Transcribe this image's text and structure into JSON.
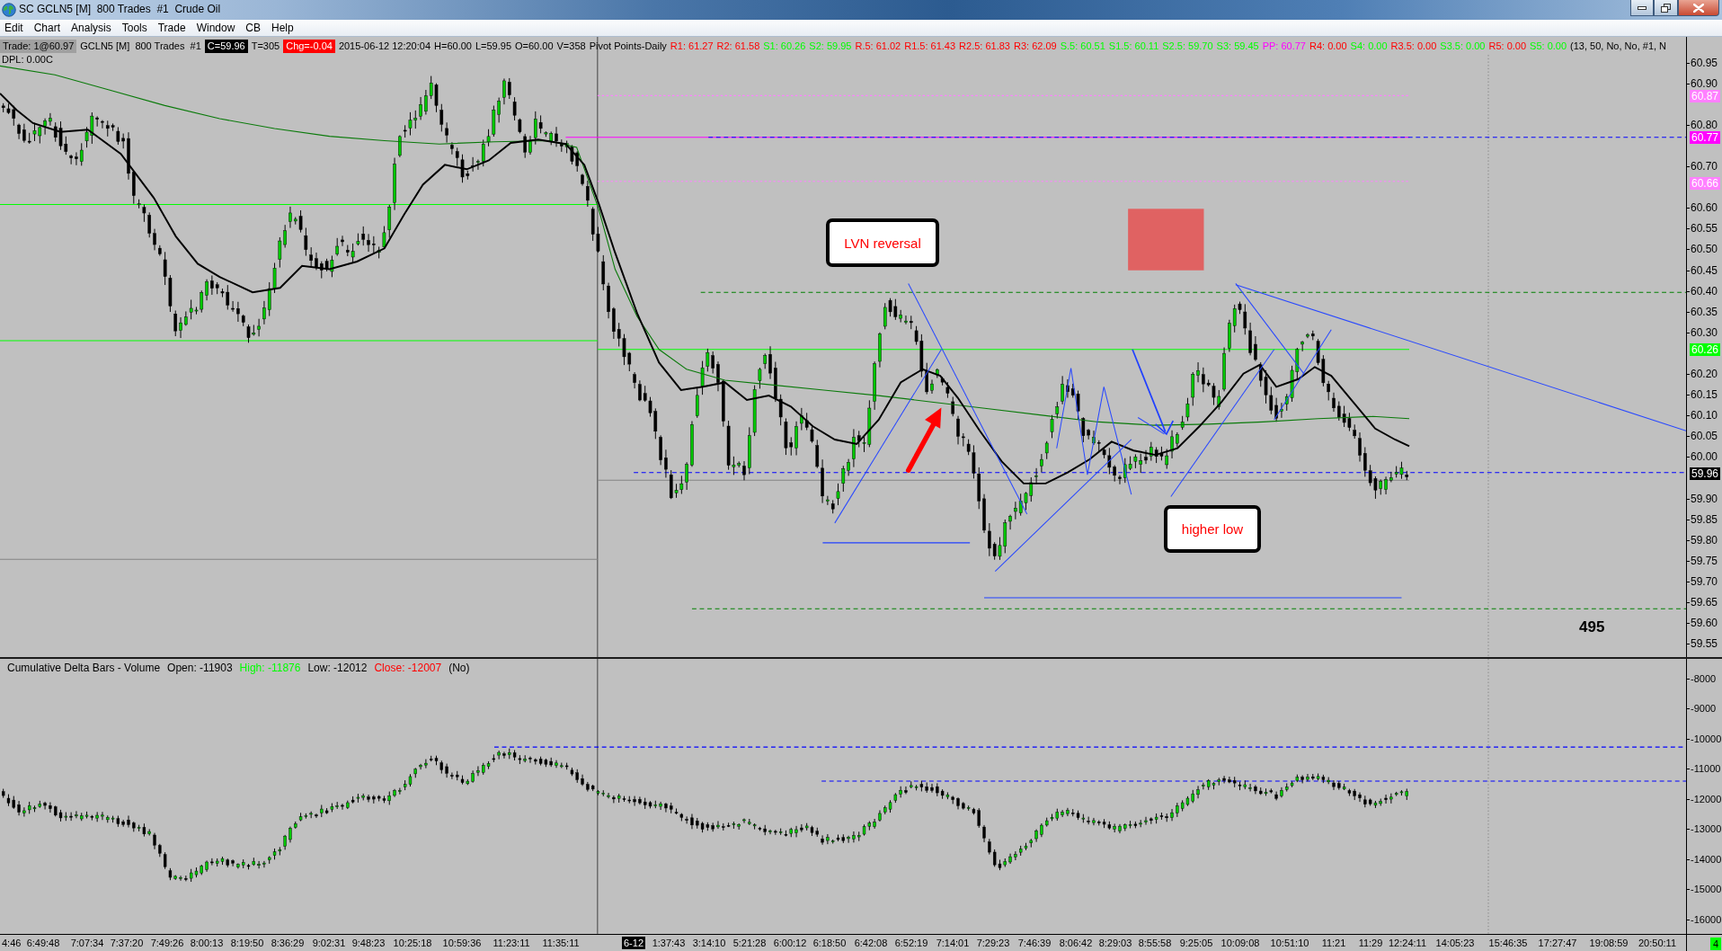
{
  "window": {
    "title": "SC GCLN5 [M]  800 Trades  #1  Crude Oil"
  },
  "menu": [
    "Edit",
    "Chart",
    "Analysis",
    "Tools",
    "Trade",
    "Window",
    "CB",
    "Help"
  ],
  "chart_header": {
    "items": [
      {
        "text": "Trade: 1@60.97",
        "kind": "tag",
        "color": "#a0a0a0"
      },
      {
        "text": "GCLN5 [M]  800 Trades  #1",
        "kind": "text"
      },
      {
        "text": "C=59.96",
        "kind": "tag",
        "color": "#000000"
      },
      {
        "text": "T=305",
        "kind": "text"
      },
      {
        "text": "Chg=-0.04",
        "kind": "tag",
        "color": "#ff0000"
      },
      {
        "text": "2015-06-12 12:20:04",
        "kind": "text"
      },
      {
        "text": "H=60.00",
        "kind": "text"
      },
      {
        "text": "L=59.95",
        "kind": "text"
      },
      {
        "text": "O=60.00",
        "kind": "text"
      },
      {
        "text": "V=358",
        "kind": "text"
      },
      {
        "text": "Pivot Points-Daily",
        "kind": "text"
      },
      {
        "text": "R1: 61.27",
        "kind": "text",
        "color": "#ff0000"
      },
      {
        "text": "R2: 61.58",
        "kind": "text",
        "color": "#ff0000"
      },
      {
        "text": "S1: 60.26",
        "kind": "text",
        "color": "#00ff00"
      },
      {
        "text": "S2: 59.95",
        "kind": "text",
        "color": "#00ff00"
      },
      {
        "text": "R.5: 61.02",
        "kind": "text",
        "color": "#ff0000"
      },
      {
        "text": "R1.5: 61.43",
        "kind": "text",
        "color": "#ff0000"
      },
      {
        "text": "R2.5: 61.83",
        "kind": "text",
        "color": "#ff0000"
      },
      {
        "text": "R3: 62.09",
        "kind": "text",
        "color": "#ff0000"
      },
      {
        "text": "S.5: 60.51",
        "kind": "text",
        "color": "#00ff00"
      },
      {
        "text": "S1.5: 60.11",
        "kind": "text",
        "color": "#00ff00"
      },
      {
        "text": "S2.5: 59.70",
        "kind": "text",
        "color": "#00ff00"
      },
      {
        "text": "S3: 59.45",
        "kind": "text",
        "color": "#00ff00"
      },
      {
        "text": "PP: 60.77",
        "kind": "text",
        "color": "#ff00ff"
      },
      {
        "text": "R4: 0.00",
        "kind": "text",
        "color": "#ff0000"
      },
      {
        "text": "S4: 0.00",
        "kind": "text",
        "color": "#00ff00"
      },
      {
        "text": "R3.5: 0.00",
        "kind": "text",
        "color": "#ff0000"
      },
      {
        "text": "S3.5: 0.00",
        "kind": "text",
        "color": "#00ff00"
      },
      {
        "text": "R5: 0.00",
        "kind": "text",
        "color": "#ff0000"
      },
      {
        "text": "S5: 0.00",
        "kind": "text",
        "color": "#00ff00"
      },
      {
        "text": "(13, 50, No, No, #1, N",
        "kind": "text"
      }
    ]
  },
  "dpl": "DPL: 0.00C",
  "annotations": [
    {
      "kind": "callout",
      "text": "LVN reversal"
    },
    {
      "kind": "callout",
      "text": "higher low"
    },
    {
      "kind": "label",
      "text": "495"
    }
  ],
  "price_axis": {
    "labels": [
      "60.95",
      "60.90",
      "60.80",
      "60.70",
      "60.60",
      "60.55",
      "60.50",
      "60.45",
      "60.40",
      "60.35",
      "60.30",
      "60.20",
      "60.15",
      "60.10",
      "60.05",
      "60.00",
      "59.90",
      "59.85",
      "59.80",
      "59.75",
      "59.70",
      "59.65",
      "59.60",
      "59.55"
    ],
    "markers": [
      {
        "label": "60.87",
        "color": "#ff80ff"
      },
      {
        "label": "60.77",
        "color": "#ff00ff"
      },
      {
        "label": "60.66",
        "color": "#ff80ff"
      },
      {
        "label": "60.26",
        "color": "#00ff00"
      },
      {
        "label": "59.96",
        "color": "#000000"
      }
    ]
  },
  "delta_panel": {
    "title": "Cumulative Delta Bars - Volume",
    "values": [
      {
        "text": "Open: -11903"
      },
      {
        "text": "High: -11876",
        "color": "#00ff00"
      },
      {
        "text": "Low: -12012"
      },
      {
        "text": "Close: -12007",
        "color": "#ff0000"
      },
      {
        "text": "(No)"
      }
    ],
    "axis_labels": [
      "-8000",
      "-9000",
      "-10000",
      "-11000",
      "-12000",
      "-13000",
      "-14000",
      "-15000",
      "-16000"
    ]
  },
  "time_axis": {
    "labels": [
      {
        "text": "4:46",
        "kind": "time"
      },
      {
        "text": "6:49:48",
        "kind": "time"
      },
      {
        "text": "7:07:34",
        "kind": "time"
      },
      {
        "text": "7:37:20",
        "kind": "time"
      },
      {
        "text": "7:49:26",
        "kind": "time"
      },
      {
        "text": "8:00:13",
        "kind": "time"
      },
      {
        "text": "8:19:50",
        "kind": "time"
      },
      {
        "text": "8:36:29",
        "kind": "time"
      },
      {
        "text": "9:02:31",
        "kind": "time"
      },
      {
        "text": "9:48:23",
        "kind": "time"
      },
      {
        "text": "10:25:18",
        "kind": "time"
      },
      {
        "text": "10:59:36",
        "kind": "time"
      },
      {
        "text": "11:23:11",
        "kind": "time"
      },
      {
        "text": "11:35:11",
        "kind": "time"
      },
      {
        "text": "6-12",
        "kind": "date"
      },
      {
        "text": "1:37:43",
        "kind": "time"
      },
      {
        "text": "3:14:10",
        "kind": "time"
      },
      {
        "text": "5:21:28",
        "kind": "time"
      },
      {
        "text": "6:00:12",
        "kind": "time"
      },
      {
        "text": "6:18:50",
        "kind": "time"
      },
      {
        "text": "6:42:08",
        "kind": "time"
      },
      {
        "text": "6:52:19",
        "kind": "time"
      },
      {
        "text": "7:14:01",
        "kind": "time"
      },
      {
        "text": "7:29:23",
        "kind": "time"
      },
      {
        "text": "7:46:39",
        "kind": "time"
      },
      {
        "text": "8:06:42",
        "kind": "time"
      },
      {
        "text": "8:29:03",
        "kind": "time"
      },
      {
        "text": "8:55:58",
        "kind": "time"
      },
      {
        "text": "9:25:05",
        "kind": "time"
      },
      {
        "text": "10:09:08",
        "kind": "time"
      },
      {
        "text": "10:51:10",
        "kind": "time"
      },
      {
        "text": "11:21",
        "kind": "time"
      },
      {
        "text": "11:29",
        "kind": "time"
      },
      {
        "text": "12:24:11",
        "kind": "time"
      },
      {
        "text": "14:05:23",
        "kind": "time"
      },
      {
        "text": "15:46:35",
        "kind": "time"
      },
      {
        "text": "17:27:47",
        "kind": "time"
      },
      {
        "text": "19:08:59",
        "kind": "time"
      },
      {
        "text": "20:50:11",
        "kind": "time"
      }
    ],
    "corner": {
      "text": "4",
      "color": "#00ff00"
    }
  }
}
